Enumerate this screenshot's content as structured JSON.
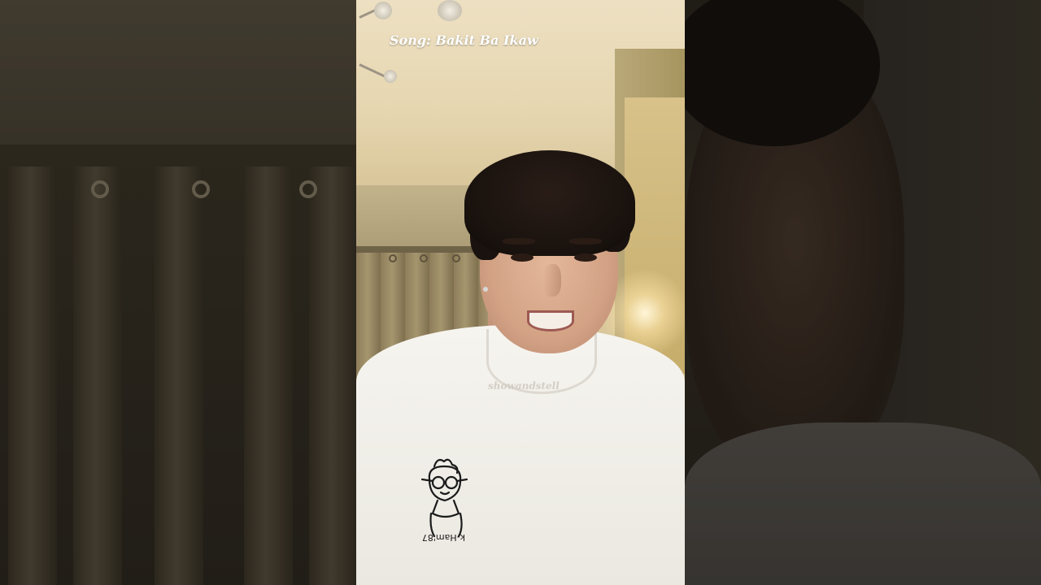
{
  "video": {
    "song_caption": "Song: Bakit Ba Ikaw",
    "watermark": "showandstell"
  },
  "colors": {
    "caption_text": "#ffffff",
    "watermark_text": "#cdc8c0",
    "background_dark": "#1a1611"
  }
}
